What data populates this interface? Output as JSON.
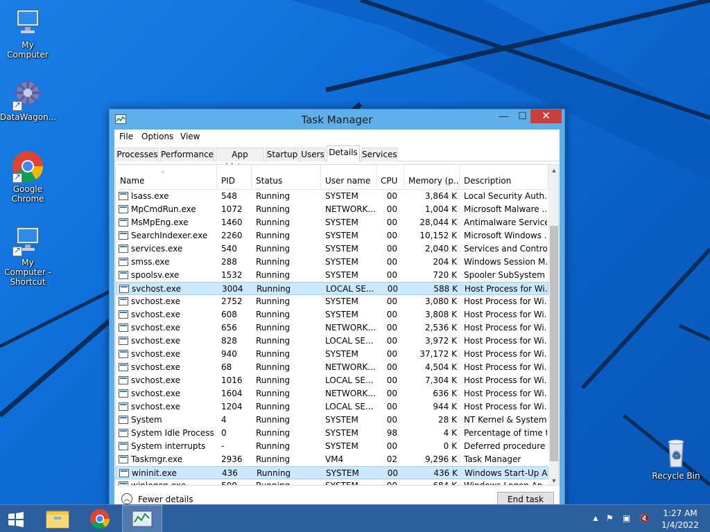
{
  "desktop": {
    "icons": [
      {
        "label": "My Computer"
      },
      {
        "label": "DataWagon..."
      },
      {
        "label": "Google Chrome"
      },
      {
        "label": "My Computer - Shortcut"
      },
      {
        "label": "Recycle Bin"
      }
    ]
  },
  "window": {
    "title": "Task Manager",
    "minimize": "—",
    "maximize": "☐",
    "close": "✕"
  },
  "menu": [
    "File",
    "Options",
    "View"
  ],
  "tabs": [
    "Processes",
    "Performance",
    "App history",
    "Startup",
    "Users",
    "Details",
    "Services"
  ],
  "active_tab": "Details",
  "columns": [
    "Name",
    "PID",
    "Status",
    "User name",
    "CPU",
    "Memory (p...",
    "Description"
  ],
  "rows": [
    {
      "name": "lsass.exe",
      "pid": "548",
      "status": "Running",
      "user": "SYSTEM",
      "cpu": "00",
      "mem": "3,864 K",
      "desc": "Local Security Auth..."
    },
    {
      "name": "MpCmdRun.exe",
      "pid": "1072",
      "status": "Running",
      "user": "NETWORK...",
      "cpu": "00",
      "mem": "1,004 K",
      "desc": "Microsoft Malware ..."
    },
    {
      "name": "MsMpEng.exe",
      "pid": "1460",
      "status": "Running",
      "user": "SYSTEM",
      "cpu": "00",
      "mem": "28,044 K",
      "desc": "Antimalware Service..."
    },
    {
      "name": "SearchIndexer.exe",
      "pid": "2260",
      "status": "Running",
      "user": "SYSTEM",
      "cpu": "00",
      "mem": "10,152 K",
      "desc": "Microsoft Windows ..."
    },
    {
      "name": "services.exe",
      "pid": "540",
      "status": "Running",
      "user": "SYSTEM",
      "cpu": "00",
      "mem": "2,040 K",
      "desc": "Services and Control..."
    },
    {
      "name": "smss.exe",
      "pid": "288",
      "status": "Running",
      "user": "SYSTEM",
      "cpu": "00",
      "mem": "204 K",
      "desc": "Windows Session M..."
    },
    {
      "name": "spoolsv.exe",
      "pid": "1532",
      "status": "Running",
      "user": "SYSTEM",
      "cpu": "00",
      "mem": "720 K",
      "desc": "Spooler SubSystem ..."
    },
    {
      "name": "svchost.exe",
      "pid": "3004",
      "status": "Running",
      "user": "LOCAL SE...",
      "cpu": "00",
      "mem": "588 K",
      "desc": "Host Process for Wi..."
    },
    {
      "name": "svchost.exe",
      "pid": "2752",
      "status": "Running",
      "user": "SYSTEM",
      "cpu": "00",
      "mem": "3,080 K",
      "desc": "Host Process for Wi..."
    },
    {
      "name": "svchost.exe",
      "pid": "608",
      "status": "Running",
      "user": "SYSTEM",
      "cpu": "00",
      "mem": "3,808 K",
      "desc": "Host Process for Wi..."
    },
    {
      "name": "svchost.exe",
      "pid": "656",
      "status": "Running",
      "user": "NETWORK...",
      "cpu": "00",
      "mem": "2,536 K",
      "desc": "Host Process for Wi..."
    },
    {
      "name": "svchost.exe",
      "pid": "828",
      "status": "Running",
      "user": "LOCAL SE...",
      "cpu": "00",
      "mem": "3,972 K",
      "desc": "Host Process for Wi..."
    },
    {
      "name": "svchost.exe",
      "pid": "940",
      "status": "Running",
      "user": "SYSTEM",
      "cpu": "00",
      "mem": "37,172 K",
      "desc": "Host Process for Wi..."
    },
    {
      "name": "svchost.exe",
      "pid": "68",
      "status": "Running",
      "user": "NETWORK...",
      "cpu": "00",
      "mem": "4,504 K",
      "desc": "Host Process for Wi..."
    },
    {
      "name": "svchost.exe",
      "pid": "1016",
      "status": "Running",
      "user": "LOCAL SE...",
      "cpu": "00",
      "mem": "7,304 K",
      "desc": "Host Process for Wi..."
    },
    {
      "name": "svchost.exe",
      "pid": "1604",
      "status": "Running",
      "user": "NETWORK...",
      "cpu": "00",
      "mem": "636 K",
      "desc": "Host Process for Wi..."
    },
    {
      "name": "svchost.exe",
      "pid": "1204",
      "status": "Running",
      "user": "LOCAL SE...",
      "cpu": "00",
      "mem": "944 K",
      "desc": "Host Process for Wi..."
    },
    {
      "name": "System",
      "pid": "4",
      "status": "Running",
      "user": "SYSTEM",
      "cpu": "00",
      "mem": "28 K",
      "desc": "NT Kernel & System"
    },
    {
      "name": "System Idle Process",
      "pid": "0",
      "status": "Running",
      "user": "SYSTEM",
      "cpu": "98",
      "mem": "4 K",
      "desc": "Percentage of time t..."
    },
    {
      "name": "System interrupts",
      "pid": "-",
      "status": "Running",
      "user": "SYSTEM",
      "cpu": "00",
      "mem": "0 K",
      "desc": "Deferred procedure ..."
    },
    {
      "name": "Taskmgr.exe",
      "pid": "2936",
      "status": "Running",
      "user": "VM4",
      "cpu": "02",
      "mem": "9,296 K",
      "desc": "Task Manager"
    },
    {
      "name": "wininit.exe",
      "pid": "436",
      "status": "Running",
      "user": "SYSTEM",
      "cpu": "00",
      "mem": "436 K",
      "desc": "Windows Start-Up A..."
    },
    {
      "name": "winlogon.exe",
      "pid": "500",
      "status": "Running",
      "user": "SYSTEM",
      "cpu": "00",
      "mem": "684 K",
      "desc": "Windows Logon Ap..."
    }
  ],
  "selected_pids": [
    "3004",
    "436"
  ],
  "footer": {
    "fewer_details": "Fewer details",
    "end_task": "End task"
  },
  "taskbar": {
    "time": "1:27 AM",
    "date": "1/4/2022"
  },
  "colors": {
    "desktop": "#0f6fd8",
    "taskbar": "#2b5f9e",
    "selection": "#cce8ff",
    "close": "#c7403a"
  }
}
